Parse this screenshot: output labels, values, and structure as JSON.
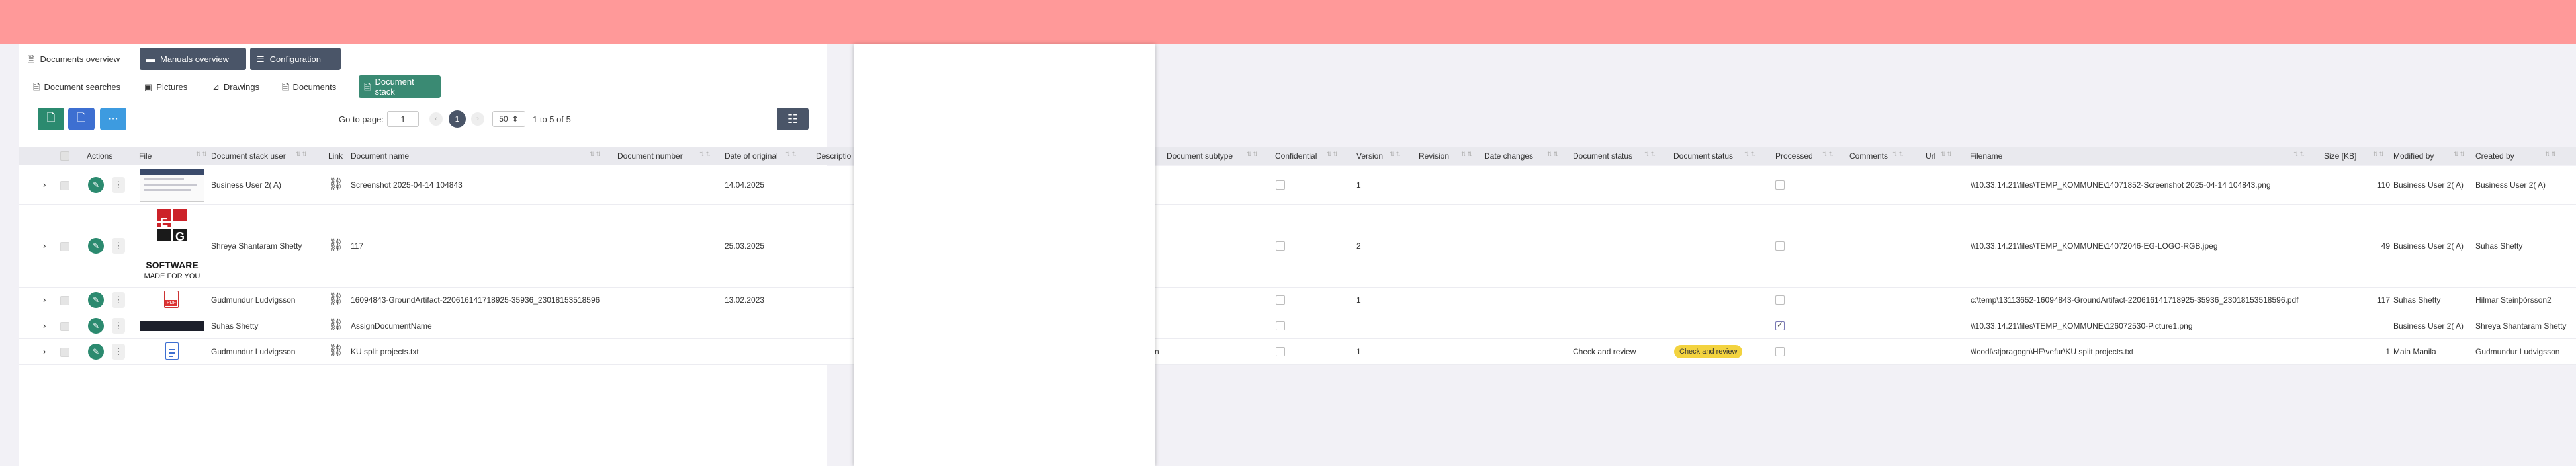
{
  "main_tabs": [
    {
      "label": "Documents overview",
      "icon": "document-icon"
    },
    {
      "label": "Manuals overview",
      "icon": "folder-icon"
    },
    {
      "label": "Configuration",
      "icon": "sliders-icon"
    }
  ],
  "sub_tabs": [
    {
      "label": "Document searches",
      "icon": "document-icon"
    },
    {
      "label": "Pictures",
      "icon": "image-icon"
    },
    {
      "label": "Drawings",
      "icon": "ruler-icon"
    },
    {
      "label": "Documents",
      "icon": "document-icon"
    },
    {
      "label": "Document stack",
      "icon": "document-icon",
      "active": true
    }
  ],
  "toolbar": {
    "buttons": [
      {
        "icon": "new-document-icon",
        "color": "#2b8a6f"
      },
      {
        "icon": "upload-document-icon",
        "color": "#3d6fd1"
      },
      {
        "icon": "more-icon",
        "label": "···",
        "color": "#3d9be0"
      }
    ],
    "goto_label": "Go to page:",
    "goto_value": "1",
    "prev_label": "‹",
    "next_label": "›",
    "current_page": "1",
    "page_size": "50",
    "page_size_arrow": "⇕",
    "range_text": "1 to 5 of 5",
    "list_icon": "list-view-icon"
  },
  "columns": {
    "actions": "Actions",
    "file": "File",
    "stack_user": "Document stack user",
    "link": "Link",
    "doc_name": "Document name",
    "doc_number": "Document number",
    "date_original": "Date of original",
    "description": "Descriptio",
    "subtype": "Document subtype",
    "confidential": "Confidential",
    "version": "Version",
    "revision": "Revision",
    "date_changes": "Date changes",
    "status1": "Document status",
    "status2": "Document status",
    "processed": "Processed",
    "comments": "Comments",
    "url": "Url",
    "filename": "Filename",
    "size": "Size [KB]",
    "modified_by": "Modified by",
    "created_by": "Created by"
  },
  "rows": [
    {
      "user": "Business User 2( A)",
      "doc_name": "Screenshot 2025-04-14 104843",
      "date": "14.04.2025",
      "version": "1",
      "status_text": "",
      "status_badge": "",
      "processed": false,
      "filename": "\\\\10.33.14.21\\files\\TEMP_KOMMUNE\\14071852-Screenshot 2025-04-14 104843.png",
      "size": "110",
      "modified_by": "Business User 2( A)",
      "created_by": "Business User 2( A)",
      "subtype_text": "",
      "thumb": "screenshot"
    },
    {
      "user": "Shreya Shantaram Shetty",
      "doc_name": "117",
      "date": "25.03.2025",
      "version": "2",
      "status_text": "",
      "status_badge": "",
      "processed": false,
      "filename": "\\\\10.33.14.21\\files\\TEMP_KOMMUNE\\14072046-EG-LOGO-RGB.jpeg",
      "size": "49",
      "modified_by": "Business User 2( A)",
      "created_by": "Suhas Shetty",
      "subtype_text": "",
      "thumb": "eg-logo"
    },
    {
      "user": "Gudmundur Ludvigsson",
      "doc_name": "16094843-GroundArtifact-22061614171892​5-35936_23018153518596",
      "date": "13.02.2023",
      "version": "1",
      "status_text": "",
      "status_badge": "",
      "processed": false,
      "filename": "c:\\temp\\13113652-16094843-GroundArtifact-22061614171892​5-35936_23018153518596.pdf",
      "size": "117",
      "modified_by": "Suhas Shetty",
      "created_by": "Hilmar Steinþórsson2",
      "subtype_text": "",
      "thumb": "pdf"
    },
    {
      "user": "Suhas Shetty",
      "doc_name": "AssignDocumentName",
      "date": "",
      "version": "",
      "status_text": "",
      "status_badge": "",
      "processed": true,
      "filename": "\\\\10.33.14.21\\files\\TEMP_KOMMUNE\\12607253​0-Picture1.png",
      "size": "",
      "modified_by": "Business User 2( A)",
      "created_by": "Shreya Shantaram Shetty",
      "subtype_text": "",
      "thumb": "dark"
    },
    {
      "user": "Gudmundur Ludvigsson",
      "doc_name": "KU split projects.txt",
      "date": "",
      "version": "1",
      "status_text": "Check and review",
      "status_badge": "Check and review",
      "processed": false,
      "filename": "\\\\lcodl\\stjoragogn\\HF\\vefur\\KU split projects.txt",
      "size": "1",
      "modified_by": "Maia Manila",
      "created_by": "Gudmundur Ludvigsson",
      "subtype_text": "n",
      "thumb": "doc"
    }
  ],
  "thumbnails": {
    "eg_logo_lines": [
      "SOFTWARE",
      "MADE FOR YOU"
    ],
    "pdf_label": "PDF"
  },
  "icons": {
    "expand": "›",
    "edit": "✎",
    "more": "⋮",
    "link": "⛓",
    "sort": "⇅⇅"
  },
  "colors": {
    "topbar": "#ff9999",
    "accent": "#2b8a6f",
    "dark": "#4a5568",
    "badge": "#f3d33f"
  }
}
